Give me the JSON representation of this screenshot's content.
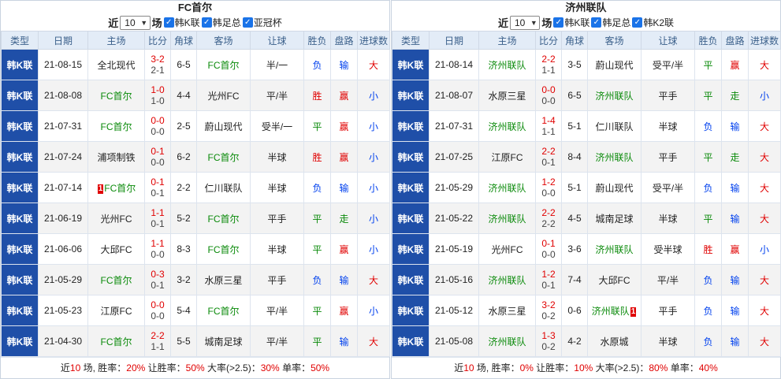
{
  "colors": {
    "header_bg": "#e3ecf7",
    "league_bg": "#1f4fa8",
    "win": "#e00000",
    "draw": "#0a8a0a",
    "loss": "#0040ee",
    "team_green": "#0a8a0a"
  },
  "panels": [
    {
      "title": "FC首尔",
      "filter": {
        "prefix": "近",
        "count": "10",
        "suffix": "场",
        "checks": [
          "韩K联",
          "韩足总",
          "亚冠杯"
        ]
      },
      "headers": [
        "类型",
        "日期",
        "主场",
        "比分",
        "角球",
        "客场",
        "让球",
        "胜负",
        "盘路",
        "进球数"
      ],
      "rows": [
        {
          "league": "韩K联",
          "date": "21-08-15",
          "home": "全北现代",
          "home_hl": false,
          "home_card": "",
          "score_ft": "3-2",
          "score_ht": "2-1",
          "corner": "6-5",
          "away": "FC首尔",
          "away_hl": true,
          "away_card": "",
          "handicap": "半/一",
          "result": "负",
          "result_color": "blue",
          "pan": "输",
          "pan_color": "blue",
          "goals": "大",
          "goals_color": "red"
        },
        {
          "league": "韩K联",
          "date": "21-08-08",
          "home": "FC首尔",
          "home_hl": true,
          "home_card": "",
          "score_ft": "1-0",
          "score_ht": "1-0",
          "corner": "4-4",
          "away": "光州FC",
          "away_hl": false,
          "away_card": "",
          "handicap": "平/半",
          "result": "胜",
          "result_color": "red",
          "pan": "赢",
          "pan_color": "red",
          "goals": "小",
          "goals_color": "blue"
        },
        {
          "league": "韩K联",
          "date": "21-07-31",
          "home": "FC首尔",
          "home_hl": true,
          "home_card": "",
          "score_ft": "0-0",
          "score_ht": "0-0",
          "corner": "2-5",
          "away": "蔚山现代",
          "away_hl": false,
          "away_card": "",
          "handicap": "受半/一",
          "result": "平",
          "result_color": "green",
          "pan": "赢",
          "pan_color": "red",
          "goals": "小",
          "goals_color": "blue"
        },
        {
          "league": "韩K联",
          "date": "21-07-24",
          "home": "浦项制铁",
          "home_hl": false,
          "home_card": "",
          "score_ft": "0-1",
          "score_ht": "0-0",
          "corner": "6-2",
          "away": "FC首尔",
          "away_hl": true,
          "away_card": "",
          "handicap": "半球",
          "result": "胜",
          "result_color": "red",
          "pan": "赢",
          "pan_color": "red",
          "goals": "小",
          "goals_color": "blue"
        },
        {
          "league": "韩K联",
          "date": "21-07-14",
          "home": "FC首尔",
          "home_hl": true,
          "home_card": "1",
          "score_ft": "0-1",
          "score_ht": "0-1",
          "corner": "2-2",
          "away": "仁川联队",
          "away_hl": false,
          "away_card": "",
          "handicap": "半球",
          "result": "负",
          "result_color": "blue",
          "pan": "输",
          "pan_color": "blue",
          "goals": "小",
          "goals_color": "blue"
        },
        {
          "league": "韩K联",
          "date": "21-06-19",
          "home": "光州FC",
          "home_hl": false,
          "home_card": "",
          "score_ft": "1-1",
          "score_ht": "0-1",
          "corner": "5-2",
          "away": "FC首尔",
          "away_hl": true,
          "away_card": "",
          "handicap": "平手",
          "result": "平",
          "result_color": "green",
          "pan": "走",
          "pan_color": "green",
          "goals": "小",
          "goals_color": "blue"
        },
        {
          "league": "韩K联",
          "date": "21-06-06",
          "home": "大邱FC",
          "home_hl": false,
          "home_card": "",
          "score_ft": "1-1",
          "score_ht": "0-0",
          "corner": "8-3",
          "away": "FC首尔",
          "away_hl": true,
          "away_card": "",
          "handicap": "半球",
          "result": "平",
          "result_color": "green",
          "pan": "赢",
          "pan_color": "red",
          "goals": "小",
          "goals_color": "blue"
        },
        {
          "league": "韩K联",
          "date": "21-05-29",
          "home": "FC首尔",
          "home_hl": true,
          "home_card": "",
          "score_ft": "0-3",
          "score_ht": "0-1",
          "corner": "3-2",
          "away": "水原三星",
          "away_hl": false,
          "away_card": "",
          "handicap": "平手",
          "result": "负",
          "result_color": "blue",
          "pan": "输",
          "pan_color": "blue",
          "goals": "大",
          "goals_color": "red"
        },
        {
          "league": "韩K联",
          "date": "21-05-23",
          "home": "江原FC",
          "home_hl": false,
          "home_card": "",
          "score_ft": "0-0",
          "score_ht": "0-0",
          "corner": "5-4",
          "away": "FC首尔",
          "away_hl": true,
          "away_card": "",
          "handicap": "平/半",
          "result": "平",
          "result_color": "green",
          "pan": "赢",
          "pan_color": "red",
          "goals": "小",
          "goals_color": "blue"
        },
        {
          "league": "韩K联",
          "date": "21-04-30",
          "home": "FC首尔",
          "home_hl": true,
          "home_card": "",
          "score_ft": "2-2",
          "score_ht": "1-1",
          "corner": "5-5",
          "away": "城南足球",
          "away_hl": false,
          "away_card": "",
          "handicap": "平/半",
          "result": "平",
          "result_color": "green",
          "pan": "输",
          "pan_color": "blue",
          "goals": "大",
          "goals_color": "red"
        }
      ],
      "summary": {
        "a": "近",
        "b": "10",
        "c": " 场, 胜率：",
        "d": "20%",
        "e": " 让胜率：",
        "f": "50%",
        "g": " 大率(>2.5)：",
        "h": "30%",
        "i": " 单率：",
        "j": "50%"
      }
    },
    {
      "title": "济州联队",
      "filter": {
        "prefix": "近",
        "count": "10",
        "suffix": "场",
        "checks": [
          "韩K联",
          "韩足总",
          "韩K2联"
        ]
      },
      "headers": [
        "类型",
        "日期",
        "主场",
        "比分",
        "角球",
        "客场",
        "让球",
        "胜负",
        "盘路",
        "进球数"
      ],
      "rows": [
        {
          "league": "韩K联",
          "date": "21-08-14",
          "home": "济州联队",
          "home_hl": true,
          "home_card": "",
          "score_ft": "2-2",
          "score_ht": "1-1",
          "corner": "3-5",
          "away": "蔚山现代",
          "away_hl": false,
          "away_card": "",
          "handicap": "受平/半",
          "result": "平",
          "result_color": "green",
          "pan": "赢",
          "pan_color": "red",
          "goals": "大",
          "goals_color": "red"
        },
        {
          "league": "韩K联",
          "date": "21-08-07",
          "home": "水原三星",
          "home_hl": false,
          "home_card": "",
          "score_ft": "0-0",
          "score_ht": "0-0",
          "corner": "6-5",
          "away": "济州联队",
          "away_hl": true,
          "away_card": "",
          "handicap": "平手",
          "result": "平",
          "result_color": "green",
          "pan": "走",
          "pan_color": "green",
          "goals": "小",
          "goals_color": "blue"
        },
        {
          "league": "韩K联",
          "date": "21-07-31",
          "home": "济州联队",
          "home_hl": true,
          "home_card": "",
          "score_ft": "1-4",
          "score_ht": "1-1",
          "corner": "5-1",
          "away": "仁川联队",
          "away_hl": false,
          "away_card": "",
          "handicap": "半球",
          "result": "负",
          "result_color": "blue",
          "pan": "输",
          "pan_color": "blue",
          "goals": "大",
          "goals_color": "red"
        },
        {
          "league": "韩K联",
          "date": "21-07-25",
          "home": "江原FC",
          "home_hl": false,
          "home_card": "",
          "score_ft": "2-2",
          "score_ht": "0-1",
          "corner": "8-4",
          "away": "济州联队",
          "away_hl": true,
          "away_card": "",
          "handicap": "平手",
          "result": "平",
          "result_color": "green",
          "pan": "走",
          "pan_color": "green",
          "goals": "大",
          "goals_color": "red"
        },
        {
          "league": "韩K联",
          "date": "21-05-29",
          "home": "济州联队",
          "home_hl": true,
          "home_card": "",
          "score_ft": "1-2",
          "score_ht": "0-0",
          "corner": "5-1",
          "away": "蔚山现代",
          "away_hl": false,
          "away_card": "",
          "handicap": "受平/半",
          "result": "负",
          "result_color": "blue",
          "pan": "输",
          "pan_color": "blue",
          "goals": "大",
          "goals_color": "red"
        },
        {
          "league": "韩K联",
          "date": "21-05-22",
          "home": "济州联队",
          "home_hl": true,
          "home_card": "",
          "score_ft": "2-2",
          "score_ht": "2-2",
          "corner": "4-5",
          "away": "城南足球",
          "away_hl": false,
          "away_card": "",
          "handicap": "半球",
          "result": "平",
          "result_color": "green",
          "pan": "输",
          "pan_color": "blue",
          "goals": "大",
          "goals_color": "red"
        },
        {
          "league": "韩K联",
          "date": "21-05-19",
          "home": "光州FC",
          "home_hl": false,
          "home_card": "",
          "score_ft": "0-1",
          "score_ht": "0-0",
          "corner": "3-6",
          "away": "济州联队",
          "away_hl": true,
          "away_card": "",
          "handicap": "受半球",
          "result": "胜",
          "result_color": "red",
          "pan": "赢",
          "pan_color": "red",
          "goals": "小",
          "goals_color": "blue"
        },
        {
          "league": "韩K联",
          "date": "21-05-16",
          "home": "济州联队",
          "home_hl": true,
          "home_card": "",
          "score_ft": "1-2",
          "score_ht": "0-1",
          "corner": "7-4",
          "away": "大邱FC",
          "away_hl": false,
          "away_card": "",
          "handicap": "平/半",
          "result": "负",
          "result_color": "blue",
          "pan": "输",
          "pan_color": "blue",
          "goals": "大",
          "goals_color": "red"
        },
        {
          "league": "韩K联",
          "date": "21-05-12",
          "home": "水原三星",
          "home_hl": false,
          "home_card": "",
          "score_ft": "3-2",
          "score_ht": "0-2",
          "corner": "0-6",
          "away": "济州联队",
          "away_hl": true,
          "away_card": "1",
          "handicap": "平手",
          "result": "负",
          "result_color": "blue",
          "pan": "输",
          "pan_color": "blue",
          "goals": "大",
          "goals_color": "red"
        },
        {
          "league": "韩K联",
          "date": "21-05-08",
          "home": "济州联队",
          "home_hl": true,
          "home_card": "",
          "score_ft": "1-3",
          "score_ht": "0-2",
          "corner": "4-2",
          "away": "水原城",
          "away_hl": false,
          "away_card": "",
          "handicap": "半球",
          "result": "负",
          "result_color": "blue",
          "pan": "输",
          "pan_color": "blue",
          "goals": "大",
          "goals_color": "red"
        }
      ],
      "summary": {
        "a": "近",
        "b": "10",
        "c": " 场, 胜率：",
        "d": "0%",
        "e": " 让胜率：",
        "f": "10%",
        "g": " 大率(>2.5)：",
        "h": "80%",
        "i": " 单率：",
        "j": "40%"
      }
    }
  ]
}
